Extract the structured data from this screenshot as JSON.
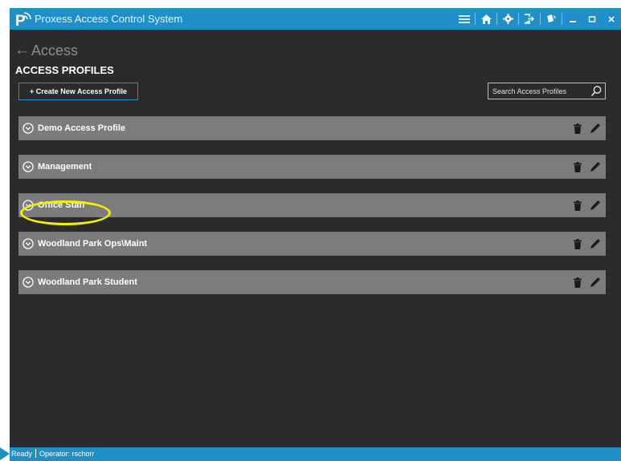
{
  "app": {
    "title": "Proxess Access Control System"
  },
  "titlebar_icons": [
    "menu-icon",
    "home-icon",
    "gear-icon",
    "logout-icon",
    "card-icon",
    "minimize-icon",
    "maximize-icon",
    "close-icon"
  ],
  "nav": {
    "back_label": "Access"
  },
  "page": {
    "title": "ACCESS PROFILES"
  },
  "toolbar": {
    "create_label": "+ Create New Access Profile",
    "search_placeholder": "Search Access Profiles"
  },
  "profiles": [
    {
      "name": "Demo Access Profile"
    },
    {
      "name": "Management"
    },
    {
      "name": "Office Staff"
    },
    {
      "name": "Woodland Park Ops\\Maint"
    },
    {
      "name": "Woodland Park Student"
    }
  ],
  "annotation": {
    "highlighted_profile": "Office Staff",
    "color": "#f4f000"
  },
  "status": {
    "state": "Ready",
    "operator": "Operator:  rschorr"
  },
  "colors": {
    "accent": "#1e8fc7",
    "background": "#2b2b2b",
    "row": "#7c7c7c"
  }
}
